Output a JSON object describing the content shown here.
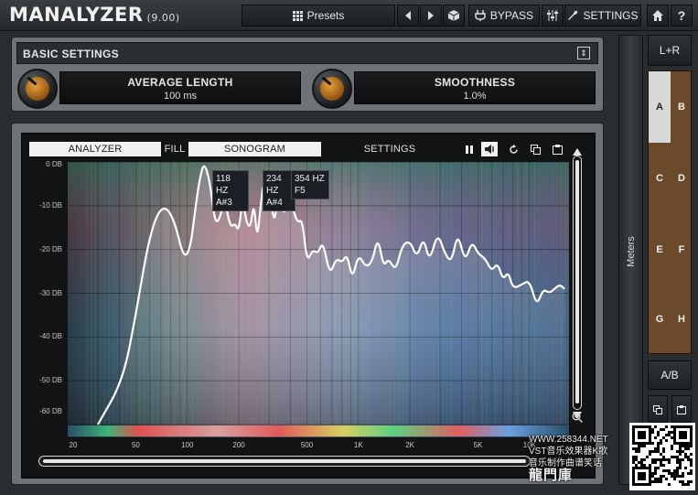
{
  "app": {
    "title": "MANALYZER",
    "version": "(9.00)"
  },
  "toolbar": {
    "presets_label": "Presets",
    "bypass_label": "BYPASS",
    "settings_label": "SETTINGS",
    "help_label": "?"
  },
  "basic_settings": {
    "title": "BASIC SETTINGS",
    "params": [
      {
        "name": "AVERAGE LENGTH",
        "value": "100 ms",
        "knob_level": 0.15
      },
      {
        "name": "SMOOTHNESS",
        "value": "1.0%",
        "knob_level": 0.15
      }
    ]
  },
  "analyzer": {
    "tabs": [
      {
        "label": "ANALYZER",
        "active": true
      },
      {
        "label": "FILL",
        "active": false
      },
      {
        "label": "SONOGRAM",
        "active": true
      },
      {
        "label": "SETTINGS",
        "active": false
      }
    ],
    "peaks": [
      {
        "freq": "118 HZ",
        "note": "A#3"
      },
      {
        "freq": "234 HZ",
        "note": "A#4"
      },
      {
        "freq": "354 HZ",
        "note": "F5"
      }
    ],
    "colors": {
      "curve": "#ffffff",
      "background": "#2c3844"
    }
  },
  "chart_data": {
    "type": "line",
    "xscale": "log",
    "xlim": [
      20,
      17000
    ],
    "ylim": [
      -60,
      0
    ],
    "yticks": [
      "0 DB",
      "-10 DB",
      "-20 DB",
      "-30 DB",
      "-40 DB",
      "-50 DB",
      "-60 DB"
    ],
    "xticks": [
      "20",
      "50",
      "100",
      "200",
      "500",
      "1K",
      "2K",
      "5K",
      "10K"
    ],
    "series": [
      {
        "x": [
          30,
          42,
          50,
          58,
          66,
          75,
          85,
          95,
          104,
          112,
          118,
          125,
          135,
          145,
          155,
          165,
          178,
          190,
          200,
          210,
          222,
          234,
          245,
          256,
          268,
          280,
          295,
          310,
          325,
          340,
          354,
          370,
          390,
          410,
          440,
          470,
          500,
          540,
          580,
          620,
          680,
          740,
          800,
          860,
          920,
          1000,
          1100,
          1200,
          1300,
          1400,
          1500,
          1650,
          1800,
          2000,
          2200,
          2400,
          2600,
          2900,
          3200,
          3500,
          3800,
          4200,
          4600,
          5000,
          5500,
          6000,
          6500,
          7000,
          7500,
          8000,
          9000,
          10000,
          11000,
          12000,
          13000,
          14000,
          15000,
          16000
        ],
        "values": [
          -60,
          -50,
          -35,
          -20,
          -12,
          -10,
          -14,
          -22,
          -20,
          -10,
          -4,
          0,
          -4,
          -14,
          -13,
          -8,
          -15,
          -14,
          -16,
          -8,
          -14,
          -15,
          -9,
          -18,
          -10,
          -4,
          -11,
          -10,
          -14,
          -6,
          -10,
          -12,
          -8,
          -10,
          -14,
          -13,
          -23,
          -20,
          -21,
          -18,
          -26,
          -22,
          -23,
          -21,
          -27,
          -21,
          -24,
          -23,
          -17,
          -24,
          -22,
          -25,
          -19,
          -18,
          -22,
          -17,
          -23,
          -16,
          -21,
          -23,
          -16,
          -23,
          -18,
          -21,
          -22,
          -25,
          -23,
          -27,
          -25,
          -29,
          -28,
          -27,
          -33,
          -29,
          -30,
          -29,
          -28,
          -29
        ]
      }
    ]
  },
  "side": {
    "meters_label": "Meters",
    "lr_label": "L+R",
    "ab_label": "A/B",
    "presets": [
      [
        "A",
        "B"
      ],
      [
        "C",
        "D"
      ],
      [
        "E",
        "F"
      ],
      [
        "G",
        "H"
      ]
    ],
    "selected_preset": "A"
  },
  "watermark": {
    "line1": "WWW.258344.NET",
    "line2": "VST音乐效果器K歌",
    "line3": "音乐制作曲谱笑话",
    "line4": "龍門庫"
  }
}
